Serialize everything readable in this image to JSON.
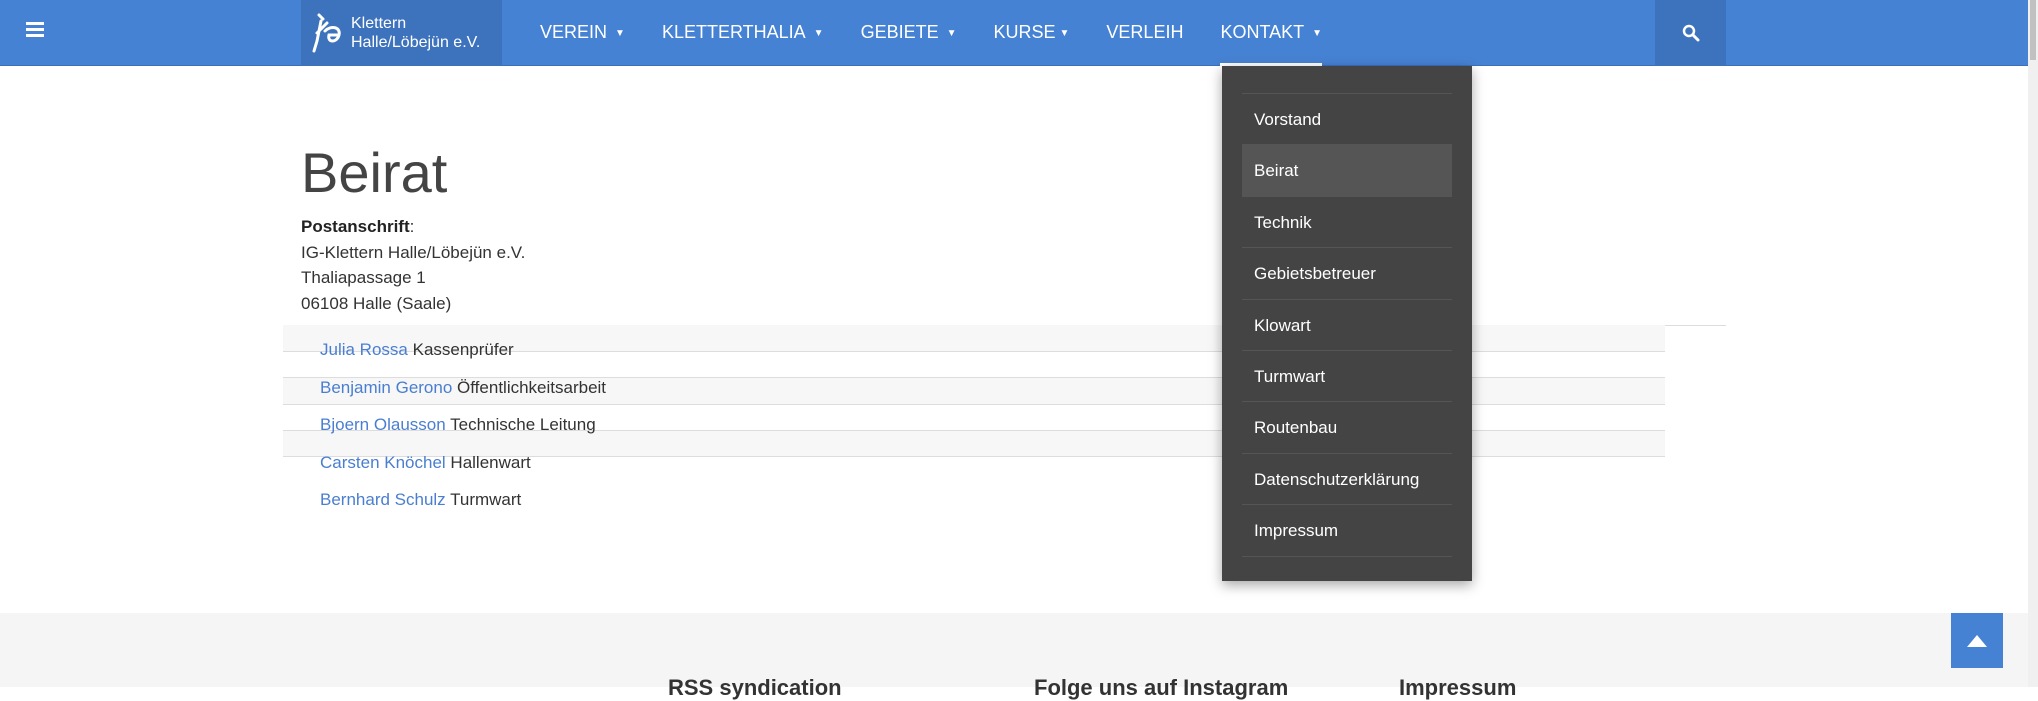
{
  "nav": {
    "logo_line1": "Klettern",
    "logo_line2": "Halle/Löbejün e.V.",
    "items": [
      {
        "label": "VEREIN",
        "caret": true
      },
      {
        "label": "KLETTERTHALIA",
        "caret": true
      },
      {
        "label": "GEBIETE",
        "caret": true
      },
      {
        "label": "KURSE",
        "caret": true
      },
      {
        "label": "VERLEIH",
        "caret": false
      },
      {
        "label": "KONTAKT",
        "caret": true
      }
    ],
    "caret": "▼"
  },
  "dropdown": [
    "Vorstand",
    "Beirat",
    "Technik",
    "Gebietsbetreuer",
    "Klowart",
    "Turmwart",
    "Routenbau",
    "Datenschutzerklärung",
    "Impressum"
  ],
  "page": {
    "title": "Beirat",
    "address_label": "Postanschrift",
    "address_colon": ":",
    "address": [
      "IG-Klettern Halle/Löbejün e.V.",
      "Thaliapassage 1",
      "06108 Halle (Saale)"
    ]
  },
  "people": [
    {
      "name": "Julia Rossa",
      "role": "Kassenprüfer"
    },
    {
      "name": "Benjamin Gerono",
      "role": "Öffentlichkeitsarbeit"
    },
    {
      "name": "Bjoern Olausson",
      "role": "Technische Leitung"
    },
    {
      "name": "Carsten Knöchel",
      "role": "Hallenwart"
    },
    {
      "name": "Bernhard Schulz",
      "role": "Turmwart"
    }
  ],
  "footer": {
    "headings": [
      "RSS syndication",
      "Folge uns auf Instagram",
      "Impressum"
    ]
  },
  "colors": {
    "nav": "#4682d3",
    "dropdown": "#444444",
    "link": "#4a7ed0"
  }
}
